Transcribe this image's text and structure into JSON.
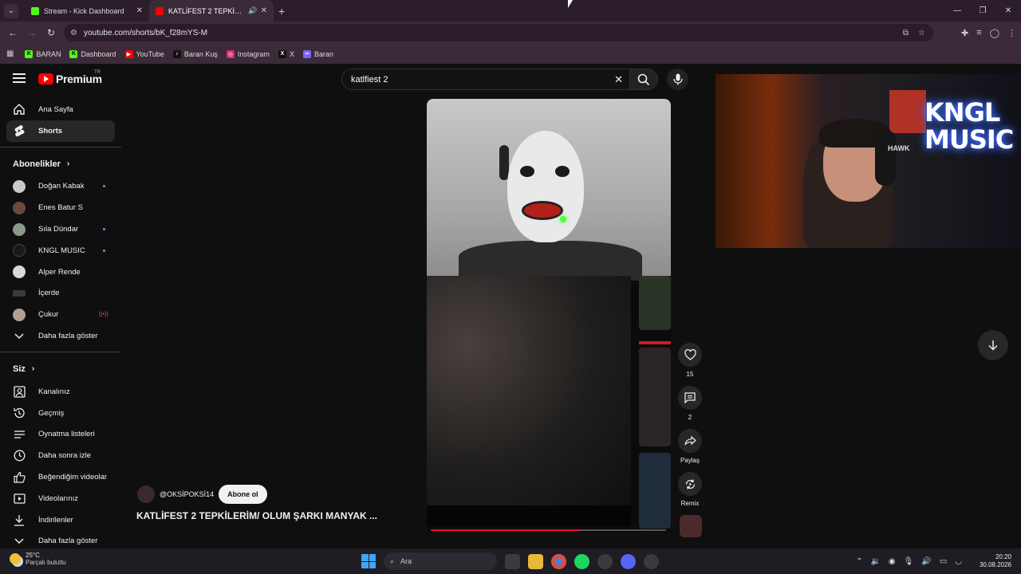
{
  "browser": {
    "tabs": [
      {
        "title": "Stream - Kick Dashboard",
        "favicon_color": "#53fc18",
        "active": false
      },
      {
        "title": "KATLİFEST 2 TEPKİLERİM/ O",
        "favicon_color": "#ff0000",
        "active": true
      }
    ],
    "address": "youtube.com/shorts/bK_f28mYS-M",
    "bookmarks": [
      {
        "label": "BARAN",
        "color": "#53fc18",
        "glyph": "K"
      },
      {
        "label": "Dashboard",
        "color": "#53fc18",
        "glyph": "K"
      },
      {
        "label": "YouTube",
        "color": "#ff0000",
        "glyph": "▶"
      },
      {
        "label": "Baran Kuş",
        "color": "#111111",
        "glyph": "♪"
      },
      {
        "label": "Instagram",
        "color": "#d62976",
        "glyph": "◎"
      },
      {
        "label": "X",
        "color": "#111111",
        "glyph": "X"
      },
      {
        "label": "Baran",
        "color": "#7b61ff",
        "glyph": "∞"
      }
    ]
  },
  "youtube": {
    "logo_text": "Premium",
    "logo_region": "TR",
    "search_value": "katlfiest 2",
    "sidebar": {
      "main": [
        {
          "label": "Ana Sayfa",
          "icon": "home-icon"
        },
        {
          "label": "Shorts",
          "icon": "shorts-icon"
        }
      ],
      "subs_header": "Abonelikler",
      "subs": [
        {
          "label": "Doğan Kabak",
          "color": "#c9c9c9",
          "dot": true
        },
        {
          "label": "Enes Batur S",
          "color": "#6b4a3a",
          "dot": false
        },
        {
          "label": "Sıla Dündar",
          "color": "#8a9a8a",
          "dot": true
        },
        {
          "label": "KNGL MUSIC",
          "color": "#1a1a1a",
          "dot": true
        },
        {
          "label": "Alper Rende",
          "color": "#d8d8d8",
          "dot": false
        },
        {
          "label": "İçerde",
          "color": "#3a3a3a",
          "dot": false
        },
        {
          "label": "Çukur",
          "color": "#b0a090",
          "live": true
        }
      ],
      "subs_more": "Daha fazla göster",
      "you_header": "Siz",
      "you": [
        {
          "label": "Kanalınız",
          "icon": "channel-icon"
        },
        {
          "label": "Geçmiş",
          "icon": "history-icon"
        },
        {
          "label": "Oynatma listeleri",
          "icon": "playlist-icon"
        },
        {
          "label": "Daha sonra izle",
          "icon": "clock-icon"
        },
        {
          "label": "Beğendiğim videolar",
          "icon": "like-icon"
        },
        {
          "label": "Videolarınız",
          "icon": "video-icon"
        },
        {
          "label": "İndirilenler",
          "icon": "download-icon"
        }
      ],
      "you_more": "Daha fazla göster"
    },
    "short": {
      "channel": "@OKSİPOKSİ14",
      "subscribe_label": "Abone ol",
      "title": "KATLİFEST 2 TEPKİLERİM/ OLUM ŞARKI MANYAK ...",
      "progress_fraction": 0.63,
      "likes": "15",
      "comments": "2",
      "share_label": "Paylaş",
      "remix_label": "Remix"
    }
  },
  "webcam": {
    "neon_line1": "KNGL",
    "neon_line2": "MUSIC",
    "headset_brand": "HAWK"
  },
  "taskbar": {
    "temp": "25°C",
    "weather": "Parçalı bulutlu",
    "search_placeholder": "Ara",
    "time": "20:20",
    "date": "30.08.2026"
  }
}
